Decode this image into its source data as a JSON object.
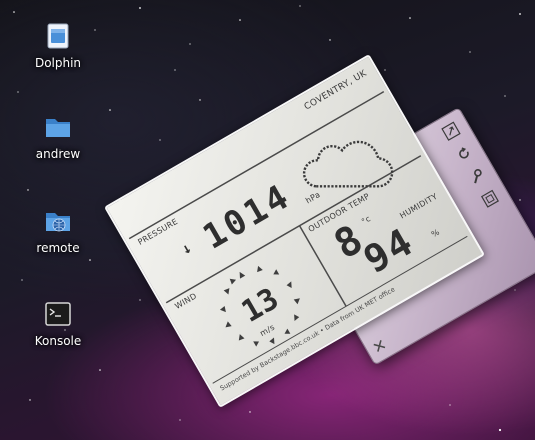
{
  "desktop": {
    "icons": [
      {
        "label": "Dolphin",
        "icon": "dolphin-app-icon"
      },
      {
        "label": "andrew",
        "icon": "folder-icon"
      },
      {
        "label": "remote",
        "icon": "network-folder-icon"
      },
      {
        "label": "Konsole",
        "icon": "terminal-icon"
      }
    ]
  },
  "weather": {
    "location": "COVENTRY, UK",
    "pressure_label": "PRESSURE",
    "pressure_value": "1014",
    "pressure_unit": "hPa",
    "pressure_trend": "↓",
    "temp_label": "OUTDOOR TEMP",
    "temp_value": "8",
    "temp_unit": "°c",
    "humidity_label": "HUMIDITY",
    "humidity_value": "94",
    "humidity_unit": "%",
    "wind_label": "WIND",
    "wind_speed": "13",
    "wind_unit": "m/s",
    "footer": "Supported by Backstage.bbc.co.uk • Data from UK MET office",
    "condition_icon": "cloud-icon"
  },
  "applet_controls": {
    "close_symbol": "✕"
  }
}
